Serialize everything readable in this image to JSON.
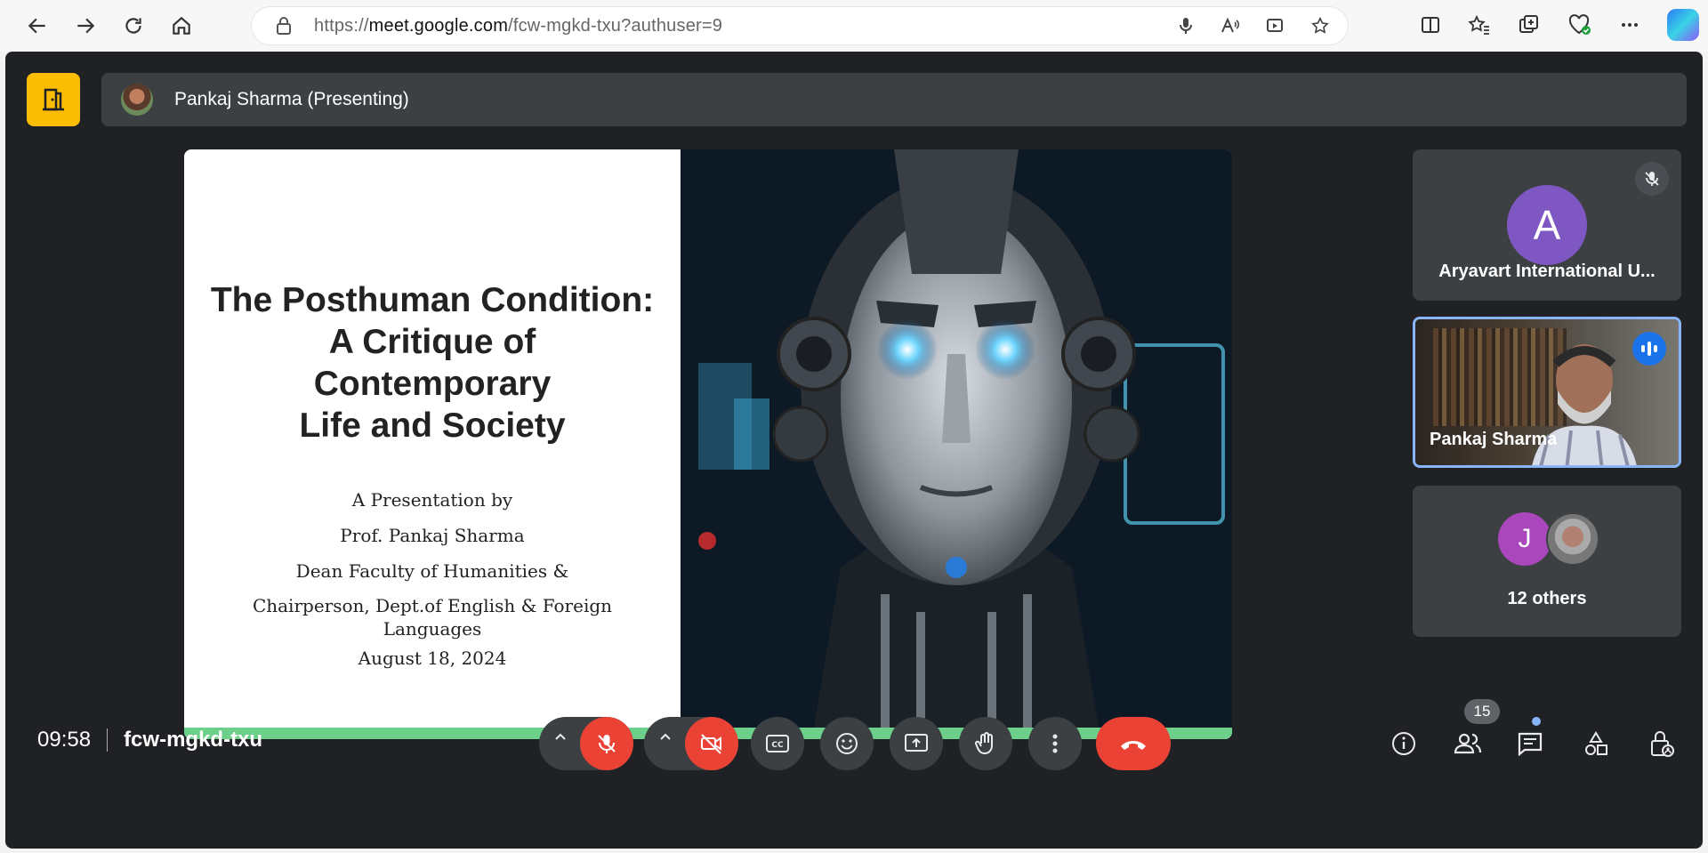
{
  "browser": {
    "url_prefix": "https://",
    "url_host": "meet.google.com",
    "url_path": "/fcw-mgkd-txu?authuser=9"
  },
  "presenter": {
    "label": "Pankaj Sharma (Presenting)"
  },
  "slide": {
    "title": "The Posthuman Condition:\nA Critique of\nContemporary\nLife and Society",
    "line1": "A Presentation by",
    "line2": "Prof. Pankaj Sharma",
    "line3": "Dean Faculty of Humanities &",
    "line4": "Chairperson, Dept.of English & Foreign Languages",
    "date": "August 18, 2024"
  },
  "participants": {
    "tile1": {
      "initial": "A",
      "name": "Aryavart International U..."
    },
    "tile2": {
      "name": "Pankaj Sharma"
    },
    "tile3": {
      "initial": "J",
      "label": "12 others"
    }
  },
  "meeting": {
    "time": "09:58",
    "code": "fcw-mgkd-txu",
    "people_count": "15"
  },
  "colors": {
    "meet_bg": "#202124",
    "tile_bg": "#3c4043",
    "red": "#ea4335",
    "yellow": "#fbbc04",
    "accent_blue": "#8ab4f8"
  }
}
